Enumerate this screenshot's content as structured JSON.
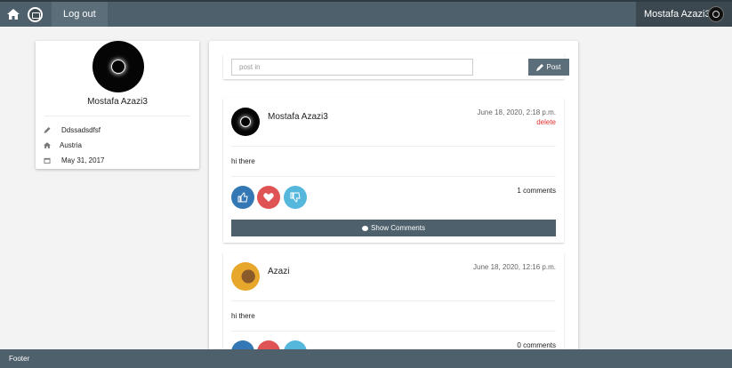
{
  "nav": {
    "home_icon": "home-icon",
    "logo_icon": "calendar-logo-icon",
    "logout_label": "Log out",
    "user_name": "Mostafa Azazi3"
  },
  "profile": {
    "name": "Mostafa Azazi3",
    "info": [
      {
        "icon": "pencil-icon",
        "text": "Ddssadsdfsf"
      },
      {
        "icon": "home-icon",
        "text": "Austria"
      },
      {
        "icon": "calendar-icon",
        "text": "May 31, 2017"
      }
    ]
  },
  "composer": {
    "placeholder": "post in",
    "post_label": "Post"
  },
  "posts": [
    {
      "author": "Mostafa Azazi3",
      "date": "June 18, 2020, 2:18 p.m.",
      "delete_label": "delete",
      "body": "hi there",
      "comments": "1 comments",
      "show_comments_label": "Show Comments"
    },
    {
      "author": "Azazi",
      "date": "June 18, 2020, 12:16 p.m.",
      "body": "hi there",
      "comments": "0 comments"
    }
  ],
  "footer": {
    "text": "Footer"
  },
  "colors": {
    "nav": "#4e606b",
    "like": "#3377b4",
    "love": "#e05354",
    "dislike": "#55b7dc",
    "delete": "#e23030"
  }
}
